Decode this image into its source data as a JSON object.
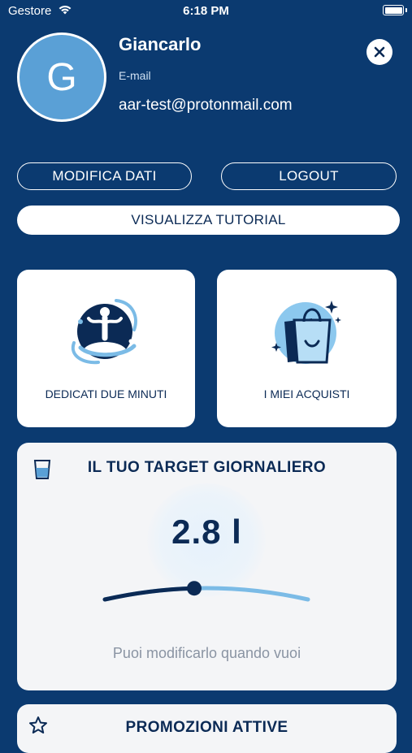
{
  "status_bar": {
    "carrier": "Gestore",
    "time": "6:18 PM",
    "battery_level": 1.0
  },
  "profile": {
    "initial": "G",
    "name": "Giancarlo",
    "email_label": "E-mail",
    "email": "aar-test@protonmail.com"
  },
  "actions": {
    "edit_label": "MODIFICA DATI",
    "logout_label": "LOGOUT",
    "tutorial_label": "VISUALIZZA TUTORIAL"
  },
  "cards": {
    "minutes_label": "DEDICATI DUE MINUTI",
    "purchases_label": "I MIEI ACQUISTI"
  },
  "target": {
    "title": "IL TUO TARGET GIORNALIERO",
    "value": "2.8 l",
    "slider_fraction": 0.44,
    "hint": "Puoi modificarlo quando vuoi"
  },
  "promo": {
    "title": "PROMOZIONI ATTIVE"
  },
  "colors": {
    "background": "#0b3a70",
    "accent": "#5aa0d6",
    "navy": "#0b2a55"
  }
}
